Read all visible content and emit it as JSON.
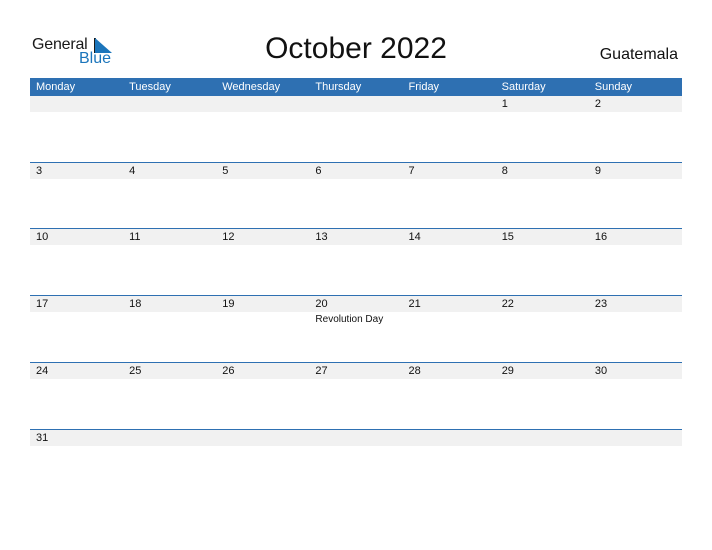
{
  "logo": {
    "general": "General",
    "blue": "Blue"
  },
  "title": "October 2022",
  "country": "Guatemala",
  "colors": {
    "accent": "#2e70b2",
    "strip": "#f1f1f1",
    "logo_blue": "#1b75bb"
  },
  "weekdays": [
    "Monday",
    "Tuesday",
    "Wednesday",
    "Thursday",
    "Friday",
    "Saturday",
    "Sunday"
  ],
  "weeks": [
    [
      "",
      "",
      "",
      "",
      "",
      "1",
      "2"
    ],
    [
      "3",
      "4",
      "5",
      "6",
      "7",
      "8",
      "9"
    ],
    [
      "10",
      "11",
      "12",
      "13",
      "14",
      "15",
      "16"
    ],
    [
      "17",
      "18",
      "19",
      "20",
      "21",
      "22",
      "23"
    ],
    [
      "24",
      "25",
      "26",
      "27",
      "28",
      "29",
      "30"
    ],
    [
      "31",
      "",
      "",
      "",
      "",
      "",
      ""
    ]
  ],
  "holidays": [
    {
      "week": 3,
      "day": 3,
      "name": "Revolution Day"
    }
  ]
}
